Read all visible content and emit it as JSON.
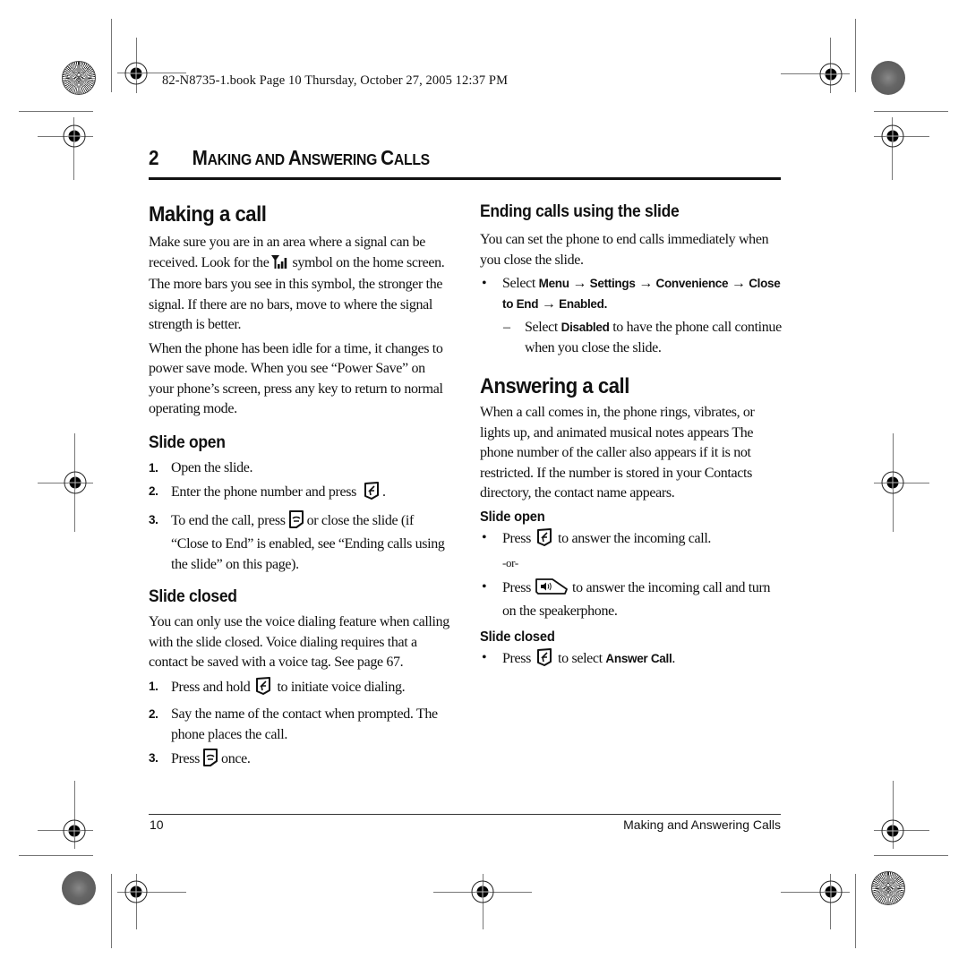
{
  "header_slug": "82-N8735-1.book  Page 10  Thursday, October 27, 2005  12:37 PM",
  "chapter": {
    "number": "2",
    "title_parts": [
      {
        "big": "M",
        "small": "AKING AND "
      },
      {
        "big": "A",
        "small": "NSWERING "
      },
      {
        "big": "C",
        "small": "ALLS"
      }
    ]
  },
  "left": {
    "making_call": {
      "heading": "Making a call",
      "para1_a": "Make sure you are in an area where a signal can be received. Look for the",
      "para1_icon": "signal-strength-icon",
      "para1_b": "symbol on the home screen. The more bars you see in this symbol, the stronger the signal. If there are no bars, move to where the signal strength is better.",
      "para2": "When the phone has been idle for a time, it changes to power save mode. When you see “Power Save” on your phone’s screen, press any key to return to normal operating mode."
    },
    "slide_open": {
      "heading": "Slide open",
      "steps": [
        {
          "n": "1.",
          "a": "Open the slide.",
          "icon": "",
          "b": ""
        },
        {
          "n": "2.",
          "a": "Enter the phone number and press",
          "icon": "send-key-icon",
          "b": "."
        },
        {
          "n": "3.",
          "a": "To end the call, press",
          "icon": "end-key-icon",
          "b": "or close the slide (if “Close to End” is enabled, see “Ending calls using the slide” on this page)."
        }
      ]
    },
    "slide_closed": {
      "heading": "Slide closed",
      "para": "You can only use the voice dialing feature when calling with the slide closed. Voice dialing requires that a contact be saved with a voice tag. See page 67.",
      "steps": [
        {
          "n": "1.",
          "a": "Press and hold",
          "icon": "send-key-icon",
          "b": "to initiate voice dialing."
        },
        {
          "n": "2.",
          "a": "Say the name of the contact when prompted. The phone places the call.",
          "icon": "",
          "b": ""
        },
        {
          "n": "3.",
          "a": "Press",
          "icon": "end-key-icon",
          "b": "once."
        }
      ]
    }
  },
  "right": {
    "ending": {
      "heading": "Ending calls using the slide",
      "para": "You can set the phone to end calls immediately when you close the slide.",
      "bullet_prefix": "Select",
      "menu_path": [
        "Menu",
        "Settings",
        "Convenience",
        "Close to End",
        "Enabled."
      ],
      "arrow": "→",
      "dash": "–",
      "sub_a": "Select",
      "sub_bold": "Disabled",
      "sub_b": "to have the phone call continue when you close the slide."
    },
    "answering": {
      "heading": "Answering a call",
      "para": "When a call comes in, the phone rings, vibrates, or lights up, and animated musical notes appears The phone number of the caller also appears if it is not restricted. If the number is stored in your Contacts directory, the contact name appears.",
      "slide_open": {
        "heading": "Slide open",
        "bullet1_a": "Press",
        "bullet1_b": "to answer the incoming call.",
        "or": "-or-",
        "bullet2_a": "Press",
        "bullet2_b": "to answer the incoming call and turn on the speakerphone."
      },
      "slide_closed": {
        "heading": "Slide closed",
        "bullet_a": "Press",
        "bullet_b": "to select",
        "bullet_bold": "Answer Call",
        "bullet_c": "."
      }
    }
  },
  "footer": {
    "page_number": "10",
    "section_title": "Making and Answering Calls"
  },
  "bullet_char": "•"
}
